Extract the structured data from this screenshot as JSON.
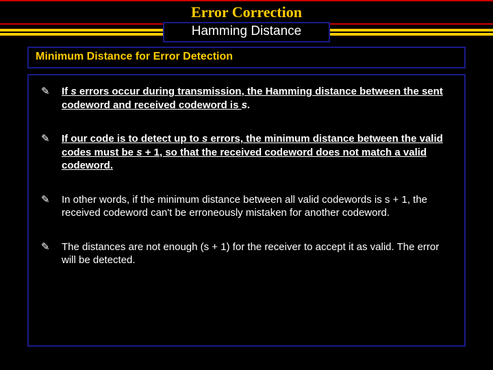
{
  "title": "Error Correction",
  "subtitle": "Hamming Distance",
  "section_header": "Minimum Distance for Error Detection",
  "bullets": {
    "b1": {
      "p1": "If ",
      "s1": "s",
      "p2": " errors occur during transmission, the Hamming distance between the sent codeword and received codeword is ",
      "s2": "s",
      "p3": "."
    },
    "b2": {
      "p1": "If our code is to detect up to ",
      "s1": "s",
      "p2": " errors, the minimum distance between the valid codes must be ",
      "s2": "s",
      "p3": " + 1, so that the received codeword does not match a valid codeword."
    },
    "b3": "In other words, if the minimum distance between all valid codewords is s + 1, the received codeword can't be erroneously mistaken for another codeword.",
    "b4": "The distances are not enough (s + 1) for the receiver to accept it as valid. The error will be detected."
  }
}
